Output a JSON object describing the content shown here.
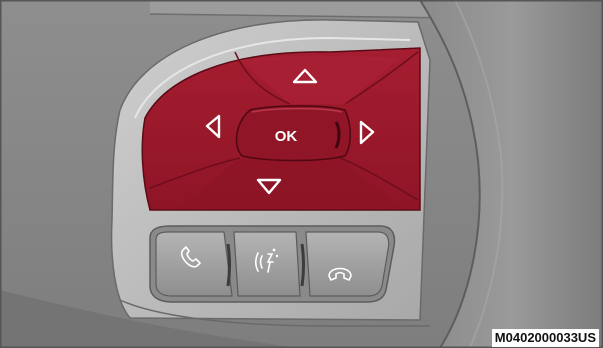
{
  "illustration": {
    "ok_label": "OK",
    "image_code": "M0402000033US"
  },
  "buttons": [
    {
      "name": "up-arrow-button",
      "icon": "triangle-up-icon"
    },
    {
      "name": "down-arrow-button",
      "icon": "triangle-down-icon"
    },
    {
      "name": "left-arrow-button",
      "icon": "triangle-left-icon"
    },
    {
      "name": "right-arrow-button",
      "icon": "triangle-right-icon"
    },
    {
      "name": "ok-button",
      "icon": "ok"
    },
    {
      "name": "phone-button",
      "icon": "phone-icon"
    },
    {
      "name": "voice-recognition-button",
      "icon": "voice-command-icon"
    },
    {
      "name": "end-call-button",
      "icon": "hang-up-icon"
    }
  ],
  "colors": {
    "background": "#8a8a8a",
    "bezel": "#bdbdbd",
    "pad": "#a01a2c",
    "pad_dark": "#7c1020",
    "button_gray": "#9e9e9e",
    "rim": "#7a7a7a"
  }
}
